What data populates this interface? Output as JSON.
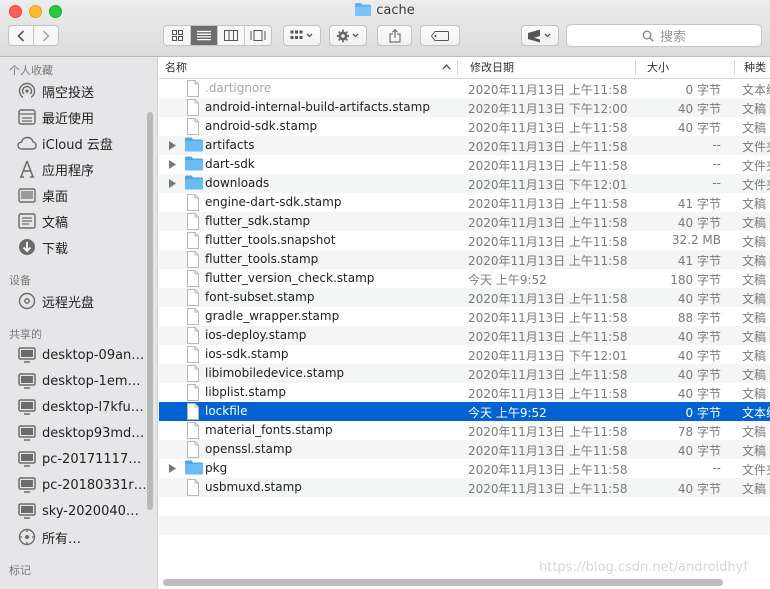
{
  "window": {
    "title": "cache"
  },
  "toolbar": {
    "search_placeholder": "搜索"
  },
  "sidebar": {
    "sections": [
      {
        "title": "个人收藏",
        "items": [
          {
            "label": "隔空投送",
            "icon": "airdrop-icon"
          },
          {
            "label": "最近使用",
            "icon": "recents-icon"
          },
          {
            "label": "iCloud 云盘",
            "icon": "icloud-icon"
          },
          {
            "label": "应用程序",
            "icon": "applications-icon"
          },
          {
            "label": "桌面",
            "icon": "desktop-icon"
          },
          {
            "label": "文稿",
            "icon": "documents-icon"
          },
          {
            "label": "下载",
            "icon": "downloads-icon"
          }
        ]
      },
      {
        "title": "设备",
        "items": [
          {
            "label": "远程光盘",
            "icon": "remote-disc-icon"
          }
        ]
      },
      {
        "title": "共享的",
        "items": [
          {
            "label": "desktop-09an…",
            "icon": "monitor-icon"
          },
          {
            "label": "desktop-1em…",
            "icon": "monitor-icon"
          },
          {
            "label": "desktop-l7kfu…",
            "icon": "monitor-icon"
          },
          {
            "label": "desktop93md…",
            "icon": "monitor-icon"
          },
          {
            "label": "pc-20171117o…",
            "icon": "monitor-icon"
          },
          {
            "label": "pc-20180331r…",
            "icon": "monitor-icon"
          },
          {
            "label": "sky-2020040…",
            "icon": "monitor-icon"
          },
          {
            "label": "所有…",
            "icon": "network-icon"
          }
        ]
      },
      {
        "title": "标记",
        "items": []
      }
    ]
  },
  "columns": {
    "name": "名称",
    "date": "修改日期",
    "size": "大小",
    "kind": "种类"
  },
  "files": [
    {
      "name": ".dartignore",
      "date": "2020年11月13日 上午11:58",
      "size": "0 字节",
      "kind": "文本编辑",
      "folder": false,
      "dim": true
    },
    {
      "name": "android-internal-build-artifacts.stamp",
      "date": "2020年11月13日 下午12:00",
      "size": "40 字节",
      "kind": "文稿",
      "folder": false
    },
    {
      "name": "android-sdk.stamp",
      "date": "2020年11月13日 上午11:58",
      "size": "40 字节",
      "kind": "文稿",
      "folder": false
    },
    {
      "name": "artifacts",
      "date": "2020年11月13日 上午11:58",
      "size": "--",
      "kind": "文件夹",
      "folder": true
    },
    {
      "name": "dart-sdk",
      "date": "2020年11月13日 上午11:58",
      "size": "--",
      "kind": "文件夹",
      "folder": true
    },
    {
      "name": "downloads",
      "date": "2020年11月13日 下午12:01",
      "size": "--",
      "kind": "文件夹",
      "folder": true
    },
    {
      "name": "engine-dart-sdk.stamp",
      "date": "2020年11月13日 上午11:58",
      "size": "41 字节",
      "kind": "文稿",
      "folder": false
    },
    {
      "name": "flutter_sdk.stamp",
      "date": "2020年11月13日 上午11:58",
      "size": "40 字节",
      "kind": "文稿",
      "folder": false
    },
    {
      "name": "flutter_tools.snapshot",
      "date": "2020年11月13日 上午11:58",
      "size": "32.2 MB",
      "kind": "文稿",
      "folder": false
    },
    {
      "name": "flutter_tools.stamp",
      "date": "2020年11月13日 上午11:58",
      "size": "41 字节",
      "kind": "文稿",
      "folder": false
    },
    {
      "name": "flutter_version_check.stamp",
      "date": "今天 上午9:52",
      "size": "180 字节",
      "kind": "文稿",
      "folder": false
    },
    {
      "name": "font-subset.stamp",
      "date": "2020年11月13日 上午11:58",
      "size": "40 字节",
      "kind": "文稿",
      "folder": false
    },
    {
      "name": "gradle_wrapper.stamp",
      "date": "2020年11月13日 上午11:58",
      "size": "88 字节",
      "kind": "文稿",
      "folder": false
    },
    {
      "name": "ios-deploy.stamp",
      "date": "2020年11月13日 上午11:58",
      "size": "40 字节",
      "kind": "文稿",
      "folder": false
    },
    {
      "name": "ios-sdk.stamp",
      "date": "2020年11月13日 下午12:01",
      "size": "40 字节",
      "kind": "文稿",
      "folder": false
    },
    {
      "name": "libimobiledevice.stamp",
      "date": "2020年11月13日 上午11:58",
      "size": "40 字节",
      "kind": "文稿",
      "folder": false
    },
    {
      "name": "libplist.stamp",
      "date": "2020年11月13日 上午11:58",
      "size": "40 字节",
      "kind": "文稿",
      "folder": false
    },
    {
      "name": "lockfile",
      "date": "今天 上午9:52",
      "size": "0 字节",
      "kind": "文本编辑",
      "folder": false,
      "selected": true
    },
    {
      "name": "material_fonts.stamp",
      "date": "2020年11月13日 上午11:58",
      "size": "78 字节",
      "kind": "文稿",
      "folder": false
    },
    {
      "name": "openssl.stamp",
      "date": "2020年11月13日 上午11:58",
      "size": "40 字节",
      "kind": "文稿",
      "folder": false
    },
    {
      "name": "pkg",
      "date": "2020年11月13日 上午11:58",
      "size": "--",
      "kind": "文件夹",
      "folder": true
    },
    {
      "name": "usbmuxd.stamp",
      "date": "2020年11月13日 上午11:58",
      "size": "40 字节",
      "kind": "文稿",
      "folder": false
    }
  ],
  "watermark": "https://blog.csdn.net/androidhyf"
}
